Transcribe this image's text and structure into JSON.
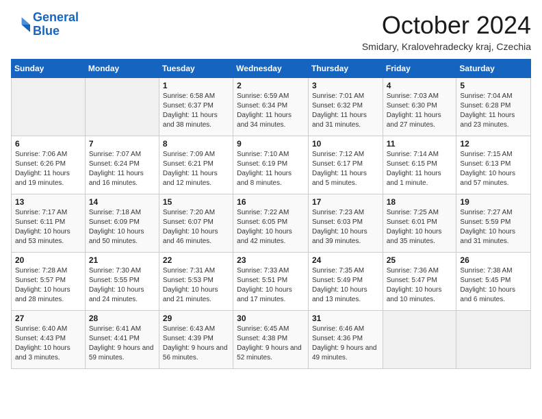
{
  "logo": {
    "line1": "General",
    "line2": "Blue"
  },
  "header": {
    "month": "October 2024",
    "location": "Smidary, Kralovehradecky kraj, Czechia"
  },
  "weekdays": [
    "Sunday",
    "Monday",
    "Tuesday",
    "Wednesday",
    "Thursday",
    "Friday",
    "Saturday"
  ],
  "weeks": [
    [
      {
        "day": "",
        "info": ""
      },
      {
        "day": "",
        "info": ""
      },
      {
        "day": "1",
        "info": "Sunrise: 6:58 AM\nSunset: 6:37 PM\nDaylight: 11 hours and 38 minutes."
      },
      {
        "day": "2",
        "info": "Sunrise: 6:59 AM\nSunset: 6:34 PM\nDaylight: 11 hours and 34 minutes."
      },
      {
        "day": "3",
        "info": "Sunrise: 7:01 AM\nSunset: 6:32 PM\nDaylight: 11 hours and 31 minutes."
      },
      {
        "day": "4",
        "info": "Sunrise: 7:03 AM\nSunset: 6:30 PM\nDaylight: 11 hours and 27 minutes."
      },
      {
        "day": "5",
        "info": "Sunrise: 7:04 AM\nSunset: 6:28 PM\nDaylight: 11 hours and 23 minutes."
      }
    ],
    [
      {
        "day": "6",
        "info": "Sunrise: 7:06 AM\nSunset: 6:26 PM\nDaylight: 11 hours and 19 minutes."
      },
      {
        "day": "7",
        "info": "Sunrise: 7:07 AM\nSunset: 6:24 PM\nDaylight: 11 hours and 16 minutes."
      },
      {
        "day": "8",
        "info": "Sunrise: 7:09 AM\nSunset: 6:21 PM\nDaylight: 11 hours and 12 minutes."
      },
      {
        "day": "9",
        "info": "Sunrise: 7:10 AM\nSunset: 6:19 PM\nDaylight: 11 hours and 8 minutes."
      },
      {
        "day": "10",
        "info": "Sunrise: 7:12 AM\nSunset: 6:17 PM\nDaylight: 11 hours and 5 minutes."
      },
      {
        "day": "11",
        "info": "Sunrise: 7:14 AM\nSunset: 6:15 PM\nDaylight: 11 hours and 1 minute."
      },
      {
        "day": "12",
        "info": "Sunrise: 7:15 AM\nSunset: 6:13 PM\nDaylight: 10 hours and 57 minutes."
      }
    ],
    [
      {
        "day": "13",
        "info": "Sunrise: 7:17 AM\nSunset: 6:11 PM\nDaylight: 10 hours and 53 minutes."
      },
      {
        "day": "14",
        "info": "Sunrise: 7:18 AM\nSunset: 6:09 PM\nDaylight: 10 hours and 50 minutes."
      },
      {
        "day": "15",
        "info": "Sunrise: 7:20 AM\nSunset: 6:07 PM\nDaylight: 10 hours and 46 minutes."
      },
      {
        "day": "16",
        "info": "Sunrise: 7:22 AM\nSunset: 6:05 PM\nDaylight: 10 hours and 42 minutes."
      },
      {
        "day": "17",
        "info": "Sunrise: 7:23 AM\nSunset: 6:03 PM\nDaylight: 10 hours and 39 minutes."
      },
      {
        "day": "18",
        "info": "Sunrise: 7:25 AM\nSunset: 6:01 PM\nDaylight: 10 hours and 35 minutes."
      },
      {
        "day": "19",
        "info": "Sunrise: 7:27 AM\nSunset: 5:59 PM\nDaylight: 10 hours and 31 minutes."
      }
    ],
    [
      {
        "day": "20",
        "info": "Sunrise: 7:28 AM\nSunset: 5:57 PM\nDaylight: 10 hours and 28 minutes."
      },
      {
        "day": "21",
        "info": "Sunrise: 7:30 AM\nSunset: 5:55 PM\nDaylight: 10 hours and 24 minutes."
      },
      {
        "day": "22",
        "info": "Sunrise: 7:31 AM\nSunset: 5:53 PM\nDaylight: 10 hours and 21 minutes."
      },
      {
        "day": "23",
        "info": "Sunrise: 7:33 AM\nSunset: 5:51 PM\nDaylight: 10 hours and 17 minutes."
      },
      {
        "day": "24",
        "info": "Sunrise: 7:35 AM\nSunset: 5:49 PM\nDaylight: 10 hours and 13 minutes."
      },
      {
        "day": "25",
        "info": "Sunrise: 7:36 AM\nSunset: 5:47 PM\nDaylight: 10 hours and 10 minutes."
      },
      {
        "day": "26",
        "info": "Sunrise: 7:38 AM\nSunset: 5:45 PM\nDaylight: 10 hours and 6 minutes."
      }
    ],
    [
      {
        "day": "27",
        "info": "Sunrise: 6:40 AM\nSunset: 4:43 PM\nDaylight: 10 hours and 3 minutes."
      },
      {
        "day": "28",
        "info": "Sunrise: 6:41 AM\nSunset: 4:41 PM\nDaylight: 9 hours and 59 minutes."
      },
      {
        "day": "29",
        "info": "Sunrise: 6:43 AM\nSunset: 4:39 PM\nDaylight: 9 hours and 56 minutes."
      },
      {
        "day": "30",
        "info": "Sunrise: 6:45 AM\nSunset: 4:38 PM\nDaylight: 9 hours and 52 minutes."
      },
      {
        "day": "31",
        "info": "Sunrise: 6:46 AM\nSunset: 4:36 PM\nDaylight: 9 hours and 49 minutes."
      },
      {
        "day": "",
        "info": ""
      },
      {
        "day": "",
        "info": ""
      }
    ]
  ]
}
